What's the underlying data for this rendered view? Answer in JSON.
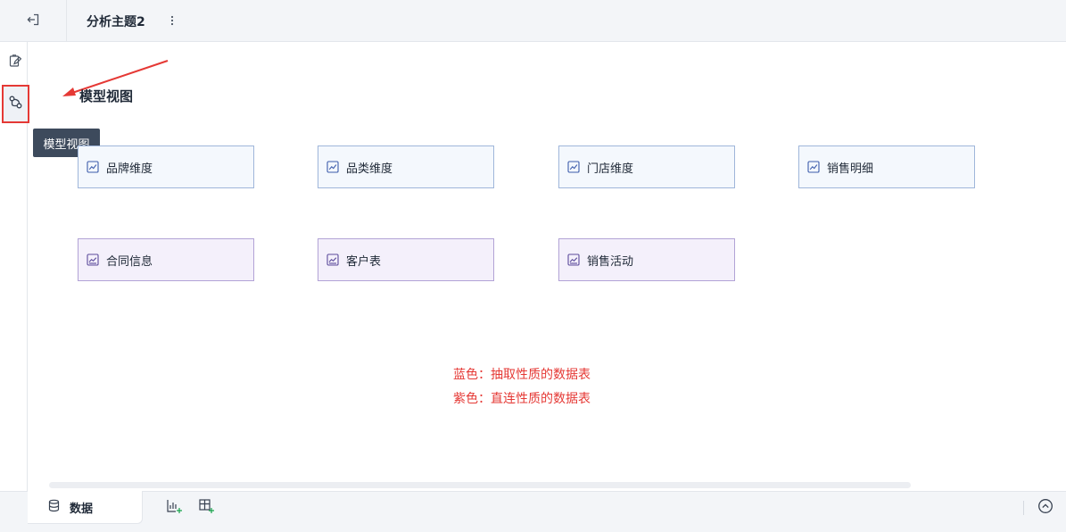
{
  "header": {
    "title": "分析主题2"
  },
  "rail": {
    "tooltip": "模型视图"
  },
  "main": {
    "section_title": "模型视图",
    "cards": [
      {
        "label": "品牌维度",
        "kind": "extract"
      },
      {
        "label": "品类维度",
        "kind": "extract"
      },
      {
        "label": "门店维度",
        "kind": "extract"
      },
      {
        "label": "销售明细",
        "kind": "extract"
      },
      {
        "label": "合同信息",
        "kind": "direct"
      },
      {
        "label": "客户表",
        "kind": "direct"
      },
      {
        "label": "销售活动",
        "kind": "direct"
      }
    ],
    "notes": [
      "蓝色：抽取性质的数据表",
      "紫色：直连性质的数据表"
    ]
  },
  "footer": {
    "data_tab": "数据"
  },
  "colors": {
    "extract_bg": "#f4f8fd",
    "direct_bg": "#f4f0fb",
    "annotation": "#e53935",
    "highlight_border": "#e53935"
  },
  "icons": [
    "exit-icon",
    "more-vertical-icon",
    "clipboard-edit-icon",
    "model-view-icon",
    "line-chart-icon",
    "database-icon",
    "add-chart-icon",
    "add-table-icon",
    "chevron-up-circle-icon"
  ]
}
